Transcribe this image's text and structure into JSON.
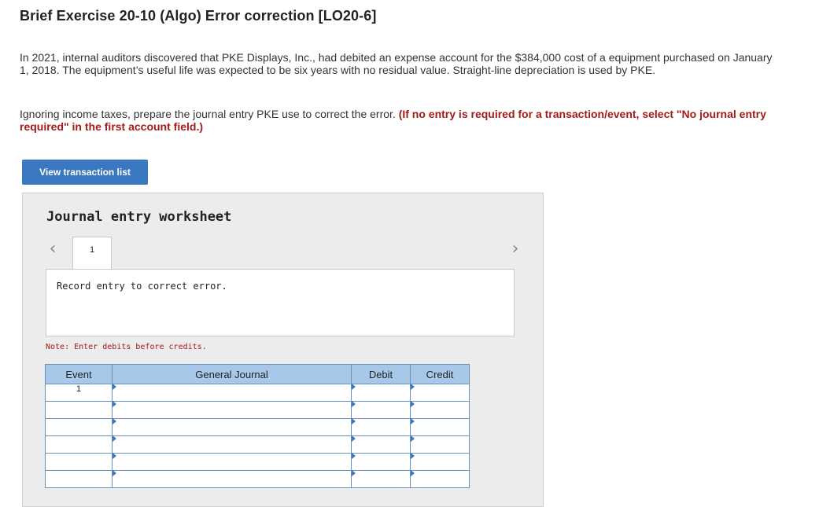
{
  "header": {
    "title": "Brief Exercise 20-10 (Algo) Error correction [LO20-6]"
  },
  "problem": {
    "paragraph1": "In 2021, internal auditors discovered that PKE Displays, Inc., had debited an expense account for the $384,000 cost of a equipment purchased on January 1, 2018. The equipment’s useful life was expected to be six years with no residual value. Straight-line depreciation is used by PKE.",
    "paragraph2_prefix": "Ignoring income taxes, prepare the journal entry PKE use to correct the error. ",
    "paragraph2_instruction": "(If no entry is required for a transaction/event, select \"No journal entry required\" in the first account field.)"
  },
  "buttons": {
    "view_transaction_list": "View transaction list"
  },
  "worksheet": {
    "title": "Journal entry worksheet",
    "tab_label": "1",
    "prev_icon": "‹",
    "next_icon": "›",
    "entry_description": "Record entry to correct error.",
    "note": "Note: Enter debits before credits.",
    "table": {
      "headers": {
        "event": "Event",
        "general_journal": "General Journal",
        "debit": "Debit",
        "credit": "Credit"
      },
      "rows": [
        {
          "event": "1",
          "account": "",
          "debit": "",
          "credit": ""
        },
        {
          "event": "",
          "account": "",
          "debit": "",
          "credit": ""
        },
        {
          "event": "",
          "account": "",
          "debit": "",
          "credit": ""
        },
        {
          "event": "",
          "account": "",
          "debit": "",
          "credit": ""
        },
        {
          "event": "",
          "account": "",
          "debit": "",
          "credit": ""
        },
        {
          "event": "",
          "account": "",
          "debit": "",
          "credit": ""
        }
      ]
    }
  },
  "colors": {
    "button_blue": "#3a78bf",
    "instruction_red": "#a11b1b",
    "table_header_blue": "#a8c8ea"
  }
}
